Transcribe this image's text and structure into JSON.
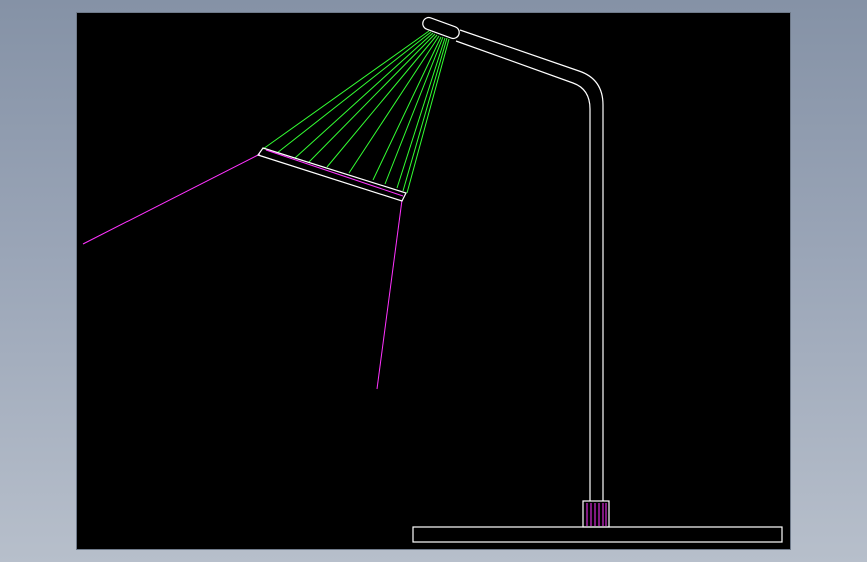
{
  "viewport": {
    "background": "#000000",
    "page_background": "#9aa5b7"
  },
  "drawing": {
    "subject": "desk-lamp",
    "colors": {
      "outline": "#ffffff",
      "shade_lines": "#33ff33",
      "light_rays": "#ff33ff",
      "hatching": "#ff33ff"
    }
  }
}
